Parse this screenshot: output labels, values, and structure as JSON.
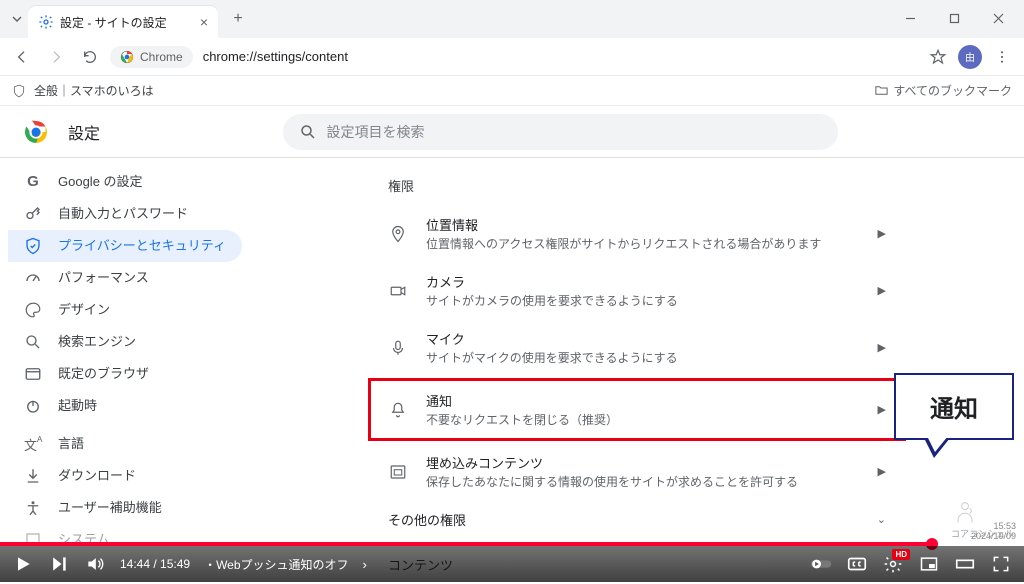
{
  "browser": {
    "tab_title": "設定 - サイトの設定",
    "chrome_chip": "Chrome",
    "url": "chrome://settings/content",
    "bookmark_item": "全般｜スマホのいろは",
    "all_bookmarks": "すべてのブックマーク"
  },
  "settings": {
    "title": "設定",
    "search_placeholder": "設定項目を検索",
    "sidebar": [
      {
        "label": "Google の設定",
        "icon": "G"
      },
      {
        "label": "自動入力とパスワード",
        "icon": "key"
      },
      {
        "label": "プライバシーとセキュリティ",
        "icon": "shield"
      },
      {
        "label": "パフォーマンス",
        "icon": "speed"
      },
      {
        "label": "デザイン",
        "icon": "palette"
      },
      {
        "label": "検索エンジン",
        "icon": "search"
      },
      {
        "label": "既定のブラウザ",
        "icon": "browser"
      },
      {
        "label": "起動時",
        "icon": "power"
      }
    ],
    "sidebar2": [
      {
        "label": "言語",
        "icon": "lang"
      },
      {
        "label": "ダウンロード",
        "icon": "download"
      },
      {
        "label": "ユーザー補助機能",
        "icon": "a11y"
      },
      {
        "label": "システム",
        "icon": "system"
      }
    ],
    "section_perm": "権限",
    "perms": [
      {
        "title": "位置情報",
        "desc": "位置情報へのアクセス権限がサイトからリクエストされる場合があります",
        "icon": "location"
      },
      {
        "title": "カメラ",
        "desc": "サイトがカメラの使用を要求できるようにする",
        "icon": "camera"
      },
      {
        "title": "マイク",
        "desc": "サイトがマイクの使用を要求できるようにする",
        "icon": "mic"
      },
      {
        "title": "通知",
        "desc": "不要なリクエストを閉じる（推奨）",
        "icon": "bell"
      },
      {
        "title": "埋め込みコンテンツ",
        "desc": "保存したあなたに関する情報の使用をサイトが求めることを許可する",
        "icon": "embed"
      }
    ],
    "other_perm": "その他の権限",
    "section_content": "コンテンツ"
  },
  "callout": {
    "label": "通知"
  },
  "watermark": "コアコンシェル",
  "player": {
    "time": "14:44 / 15:49",
    "chapter": "・Webプッシュ通知のオフ",
    "hd": "HD"
  },
  "clock": {
    "time": "15:53",
    "date": "2024/10/09"
  }
}
